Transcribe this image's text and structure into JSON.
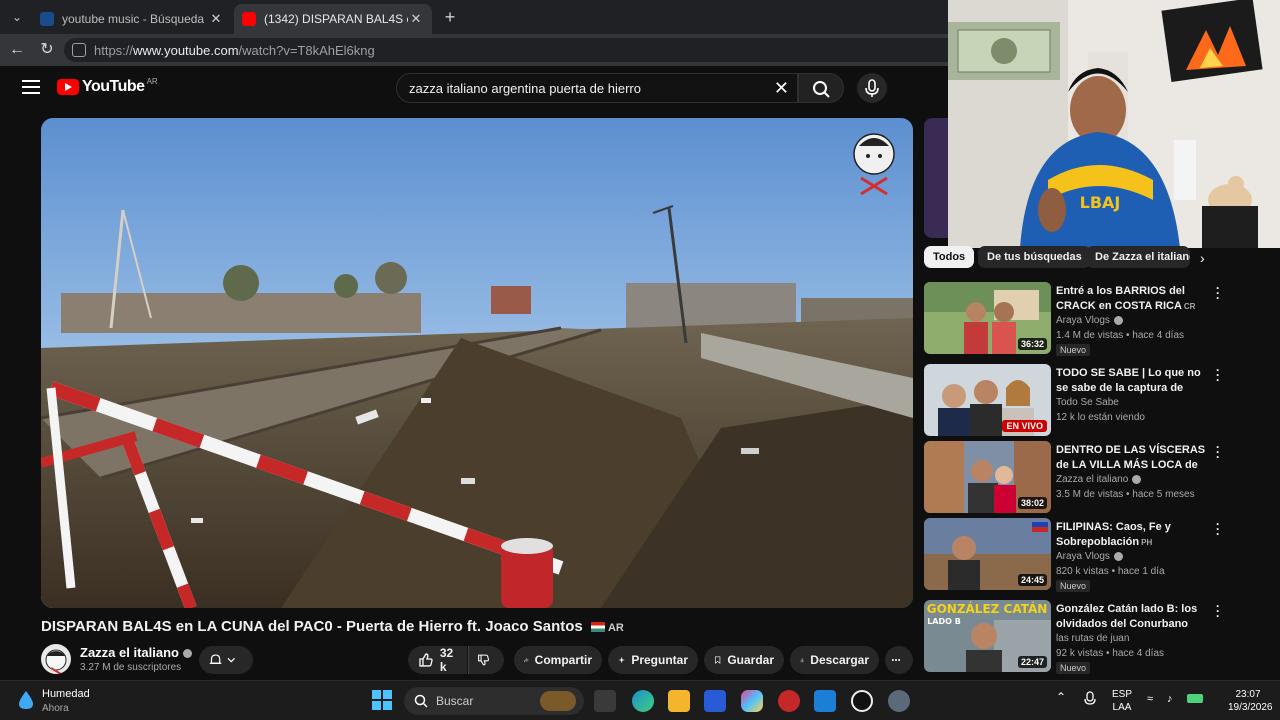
{
  "browser": {
    "tabs": [
      {
        "title": "youtube music - Búsqueda",
        "active": false
      },
      {
        "title": "(1342) DISPARAN BAL4S en LA CU",
        "active": true
      }
    ],
    "url_prefix": "https://",
    "url_host": "www.youtube.com",
    "url_path": "/watch?v=T8kAhEl6kng"
  },
  "youtube": {
    "logo_text": "YouTube",
    "country_code": "AR",
    "search_query": "zazza italiano argentina puerta de hierro",
    "brand_color": "#ff0000"
  },
  "video": {
    "title": "DISPARAN BAL4S en LA CUNA del PAC0 - Puerta de Hierro ft. Joaco Santos",
    "title_suffix_code": "AR",
    "channel_name": "Zazza el italiano",
    "subscribers": "3.27 M de suscriptores",
    "likes": "32 k",
    "actions": {
      "share": "Compartir",
      "ask": "Preguntar",
      "save": "Guardar",
      "download": "Descargar"
    }
  },
  "chips": [
    "Todos",
    "De tus búsquedas",
    "De Zazza el italiano"
  ],
  "recommendations": [
    {
      "title": "Entré a los BARRIOS del CRACK en COSTA RICA",
      "cc": "CR",
      "channel": "Araya Vlogs",
      "verified": true,
      "meta": "1.4 M de vistas • hace 4 días",
      "badge": "Nuevo",
      "duration": "36:32",
      "live": ""
    },
    {
      "title": "TODO SE SABE | Lo que no se sabe de la captura de Marset",
      "cc": "",
      "channel": "Todo Se Sabe",
      "verified": false,
      "meta": "12 k lo están viendo",
      "badge": "",
      "duration": "",
      "live": "EN VIVO"
    },
    {
      "title": "DENTRO DE LAS VÍSCERAS de LA VILLA MÁS LOCA de ...",
      "cc": "",
      "channel": "Zazza el italiano",
      "verified": true,
      "meta": "3.5 M de vistas • hace 5 meses",
      "badge": "",
      "duration": "38:02",
      "live": ""
    },
    {
      "title": "FILIPINAS: Caos, Fe y Sobrepoblación",
      "cc": "PH",
      "channel": "Araya Vlogs",
      "verified": true,
      "meta": "820 k vistas • hace 1 día",
      "badge": "Nuevo",
      "duration": "24:45",
      "live": ""
    },
    {
      "title": "González Catán lado B: los olvidados del Conurbano",
      "cc": "",
      "channel": "las rutas de juan",
      "verified": false,
      "meta": "92 k vistas • hace 4 días",
      "badge": "Nuevo",
      "duration": "22:47",
      "live": ""
    }
  ],
  "thumb_text": {
    "catan_top": "GONZÁLEZ CATÁN",
    "catan_sub": "LADO B"
  },
  "webcam_shirt_text": "LBAJ",
  "taskbar": {
    "weather_title": "Humedad",
    "weather_sub": "Ahora",
    "search_placeholder": "Buscar",
    "lang_top": "ESP",
    "lang_bottom": "LAA",
    "time": "23:07",
    "date": "19/3/2026"
  }
}
